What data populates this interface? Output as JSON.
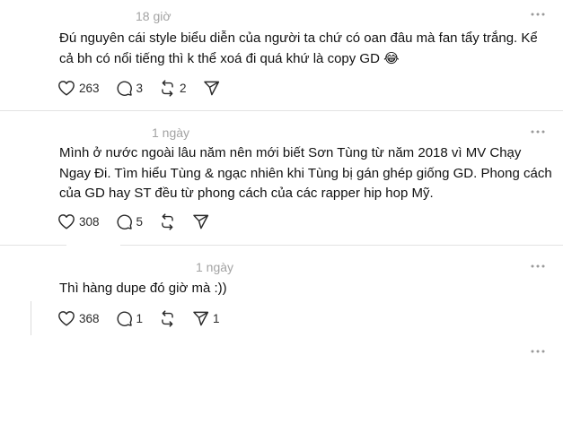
{
  "posts": [
    {
      "time": "18 giờ",
      "text": "Đú nguyên cái style biểu diễn của người ta chứ có oan đâu mà fan tẩy trắng. Kể cả bh có nổi tiếng thì k thể xoá đi quá khứ là copy GD 😂",
      "likes": "263",
      "comments": "3",
      "reposts": "2",
      "shares": ""
    },
    {
      "time": "1 ngày",
      "text": "Mình ở nước ngoài lâu năm nên mới biết Sơn Tùng từ năm 2018 vì MV Chạy Ngay Đi. Tìm hiểu Tùng & ngạc nhiên khi Tùng bị gán ghép giống GD. Phong cách của GD hay ST đều từ phong cách của các rapper hip hop Mỹ.",
      "likes": "308",
      "comments": "5",
      "reposts": "",
      "shares": ""
    },
    {
      "time": "1 ngày",
      "text": "Thì hàng dupe đó giờ mà :))",
      "likes": "368",
      "comments": "1",
      "reposts": "",
      "shares": "1"
    }
  ],
  "icons": {
    "more": "more-icon",
    "like": "heart-icon",
    "comment": "comment-icon",
    "repost": "repost-icon",
    "share": "share-icon"
  },
  "colors": {
    "text": "#111111",
    "muted": "#a3a3a3",
    "divider": "#e3e3e3"
  }
}
